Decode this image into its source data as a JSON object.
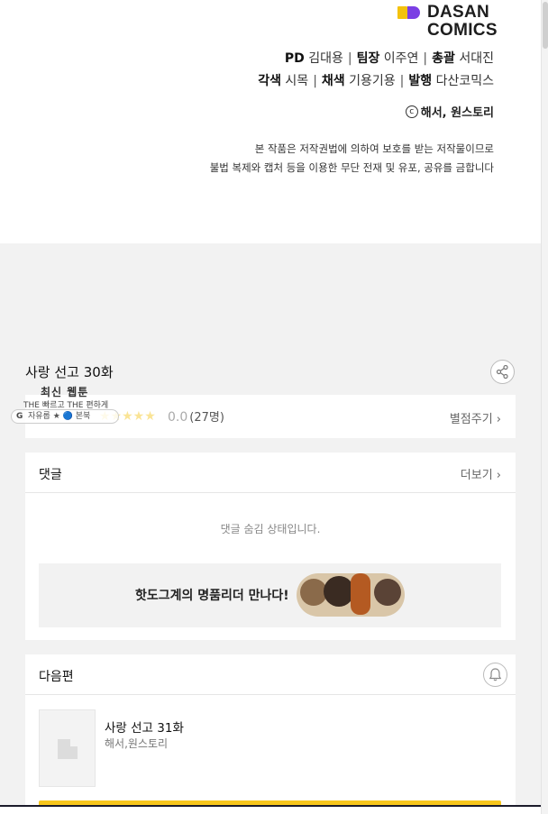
{
  "logo": {
    "line1": "DASAN",
    "line2": "COMICS",
    "brand_colors": [
      "#f4c20d",
      "#7b3fe4"
    ]
  },
  "credits": {
    "row1": [
      {
        "role": "PD",
        "name": "김대용"
      },
      {
        "role": "팀장",
        "name": "이주연"
      },
      {
        "role": "총괄",
        "name": "서대진"
      }
    ],
    "row2": [
      {
        "role": "각색",
        "name": "시목"
      },
      {
        "role": "채색",
        "name": "기용기용"
      },
      {
        "role": "발행",
        "name": "다산코믹스"
      }
    ],
    "separator": "|"
  },
  "copyright": {
    "symbol": "c",
    "text": "해서, 원스토리"
  },
  "notice": {
    "line1": "본 작품은 저작권법에 의하여 보호를 받는 저작물이므로",
    "line2": "불법 복제와 캡처 등을 이용한 무단 전재 및 유포, 공유를 금합니다"
  },
  "episode": {
    "title": "사랑 선고 30화"
  },
  "ad_overlay": {
    "latest": "최신 웹툰",
    "tagline": "THE 빠르고 THE 편하게",
    "google": "G",
    "pill_text": "자유롭 ★ 🔵 본북"
  },
  "rating": {
    "stars": "★★★★★",
    "score": "0.0",
    "count": "(27명)",
    "action": "별점주기 ›"
  },
  "comments": {
    "title": "댓글",
    "more": "더보기 ›",
    "hidden_message": "댓글 숨김 상태입니다."
  },
  "banner": {
    "text": "핫도그계의 명품리더 만나다!"
  },
  "next": {
    "title": "다음편",
    "episode_title": "사랑 선고 31화",
    "author": "해서,원스토리"
  }
}
